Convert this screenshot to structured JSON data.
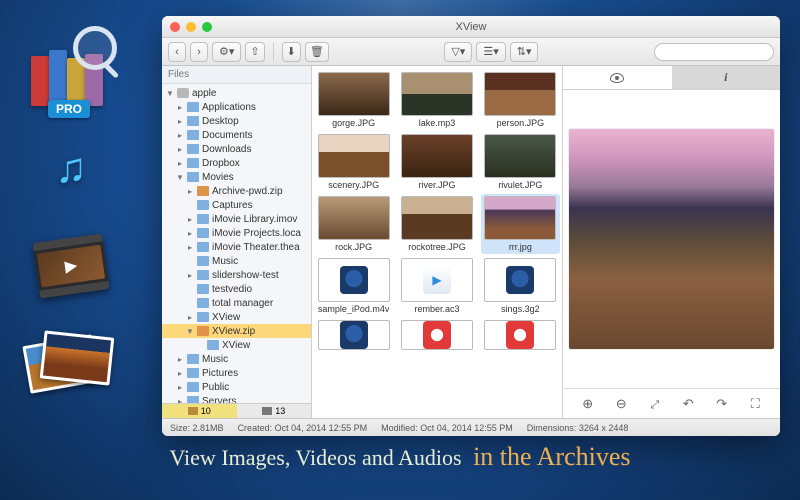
{
  "caption": {
    "part1": "View Images, Videos and Audios",
    "part2": "in the Archives"
  },
  "badge": "PRO",
  "window": {
    "title": "XView",
    "toolbar": {
      "back": "‹",
      "fwd": "›",
      "gear": "⚙",
      "share": "⇧",
      "save": "⬇",
      "trash": "🗑",
      "filter": "▽",
      "list": "☰",
      "sort": "⇅",
      "search_placeholder": ""
    },
    "sidebar": {
      "header": "Files",
      "items": [
        {
          "depth": 0,
          "expand": "▼",
          "icon": "disk",
          "label": "apple"
        },
        {
          "depth": 1,
          "expand": "▸",
          "icon": "folder",
          "label": "Applications"
        },
        {
          "depth": 1,
          "expand": "▸",
          "icon": "folder",
          "label": "Desktop"
        },
        {
          "depth": 1,
          "expand": "▸",
          "icon": "folder",
          "label": "Documents"
        },
        {
          "depth": 1,
          "expand": "▸",
          "icon": "folder",
          "label": "Downloads"
        },
        {
          "depth": 1,
          "expand": "▸",
          "icon": "folder",
          "label": "Dropbox"
        },
        {
          "depth": 1,
          "expand": "▼",
          "icon": "folder",
          "label": "Movies"
        },
        {
          "depth": 2,
          "expand": "▸",
          "icon": "zip",
          "label": "Archive-pwd.zip"
        },
        {
          "depth": 2,
          "expand": "",
          "icon": "folder",
          "label": "Captures"
        },
        {
          "depth": 2,
          "expand": "▸",
          "icon": "folder",
          "label": "iMovie Library.imov"
        },
        {
          "depth": 2,
          "expand": "▸",
          "icon": "folder",
          "label": "iMovie Projects.loca"
        },
        {
          "depth": 2,
          "expand": "▸",
          "icon": "folder",
          "label": "iMovie Theater.thea"
        },
        {
          "depth": 2,
          "expand": "",
          "icon": "folder",
          "label": "Music"
        },
        {
          "depth": 2,
          "expand": "▸",
          "icon": "folder",
          "label": "slidershow-test"
        },
        {
          "depth": 2,
          "expand": "",
          "icon": "folder",
          "label": "testvedio"
        },
        {
          "depth": 2,
          "expand": "",
          "icon": "folder",
          "label": "total manager"
        },
        {
          "depth": 2,
          "expand": "▸",
          "icon": "folder",
          "label": "XView"
        },
        {
          "depth": 2,
          "expand": "▼",
          "icon": "zip",
          "label": "XView.zip",
          "selected": true
        },
        {
          "depth": 3,
          "expand": "",
          "icon": "folder",
          "label": "XView"
        },
        {
          "depth": 1,
          "expand": "▸",
          "icon": "folder",
          "label": "Music"
        },
        {
          "depth": 1,
          "expand": "▸",
          "icon": "folder",
          "label": "Pictures"
        },
        {
          "depth": 1,
          "expand": "▸",
          "icon": "folder",
          "label": "Public"
        },
        {
          "depth": 1,
          "expand": "▸",
          "icon": "folder",
          "label": "Servers"
        }
      ],
      "footer": {
        "folders": "10",
        "images": "13"
      }
    },
    "grid": [
      [
        {
          "label": "gorge.JPG",
          "thumb": "t-gorge"
        },
        {
          "label": "lake.mp3",
          "thumb": "t-lake"
        },
        {
          "label": "person.JPG",
          "thumb": "t-person"
        }
      ],
      [
        {
          "label": "scenery.JPG",
          "thumb": "t-scenery"
        },
        {
          "label": "river.JPG",
          "thumb": "t-river"
        },
        {
          "label": "rivulet.JPG",
          "thumb": "t-rivulet"
        }
      ],
      [
        {
          "label": "rock.JPG",
          "thumb": "t-rock"
        },
        {
          "label": "rockotree.JPG",
          "thumb": "t-rockotree"
        },
        {
          "label": "rrr.jpg",
          "thumb": "t-rrr",
          "selected": true
        }
      ],
      [
        {
          "label": "sample_iPod.m4v",
          "thumb": "generic",
          "gicon": "qt"
        },
        {
          "label": "rember.ac3",
          "thumb": "generic",
          "gicon": "play"
        },
        {
          "label": "sings.3g2",
          "thumb": "generic",
          "gicon": "qt"
        }
      ],
      [
        {
          "label": "",
          "thumb": "generic",
          "gicon": "qt",
          "small": true
        },
        {
          "label": "",
          "thumb": "generic",
          "gicon": "itunes",
          "small": true
        },
        {
          "label": "",
          "thumb": "generic",
          "gicon": "itunes",
          "small": true
        }
      ]
    ],
    "status": {
      "size_label": "Size:",
      "size": "2.81MB",
      "created_label": "Created:",
      "created": "Oct 04, 2014 12:55 PM",
      "modified_label": "Modified:",
      "modified": "Oct 04, 2014 12:55 PM",
      "dim_label": "Dimensions:",
      "dim": "3264 x 2448"
    },
    "preview": {
      "tab_eye": "preview",
      "tab_info": "i",
      "controls": [
        "zoomin",
        "zoomout",
        "fit",
        "rotl",
        "rotr",
        "full"
      ]
    }
  }
}
